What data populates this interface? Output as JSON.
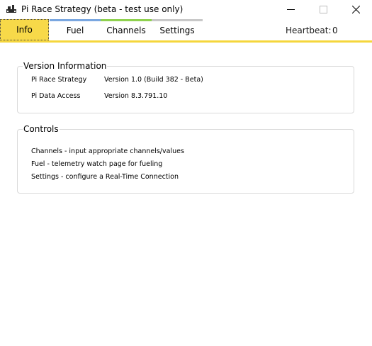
{
  "window": {
    "title": "Pi Race Strategy (beta - test use only)",
    "icon": "app-logo-icon"
  },
  "tabs": [
    {
      "label": "Info",
      "color": "#f7d949",
      "selected": true
    },
    {
      "label": "Fuel",
      "color": "#7aa7e0",
      "selected": false
    },
    {
      "label": "Channels",
      "color": "#8fd14f",
      "selected": false
    },
    {
      "label": "Settings",
      "color": "#c8c8c8",
      "selected": false
    }
  ],
  "heartbeat": {
    "label": "Heartbeat:",
    "value": "0"
  },
  "version_info": {
    "title": "Version Information",
    "rows": [
      {
        "key": "Pi Race Strategy",
        "value": "Version 1.0 (Build 382 - Beta)"
      },
      {
        "key": "Pi Data Access",
        "value": "Version 8.3.791.10"
      }
    ]
  },
  "controls": {
    "title": "Controls",
    "lines": [
      "Channels - input appropriate channels/values",
      "Fuel - telemetry watch page for fueling",
      "Settings - configure a Real-Time Connection"
    ]
  },
  "colors": {
    "accent": "#f5d63c"
  }
}
